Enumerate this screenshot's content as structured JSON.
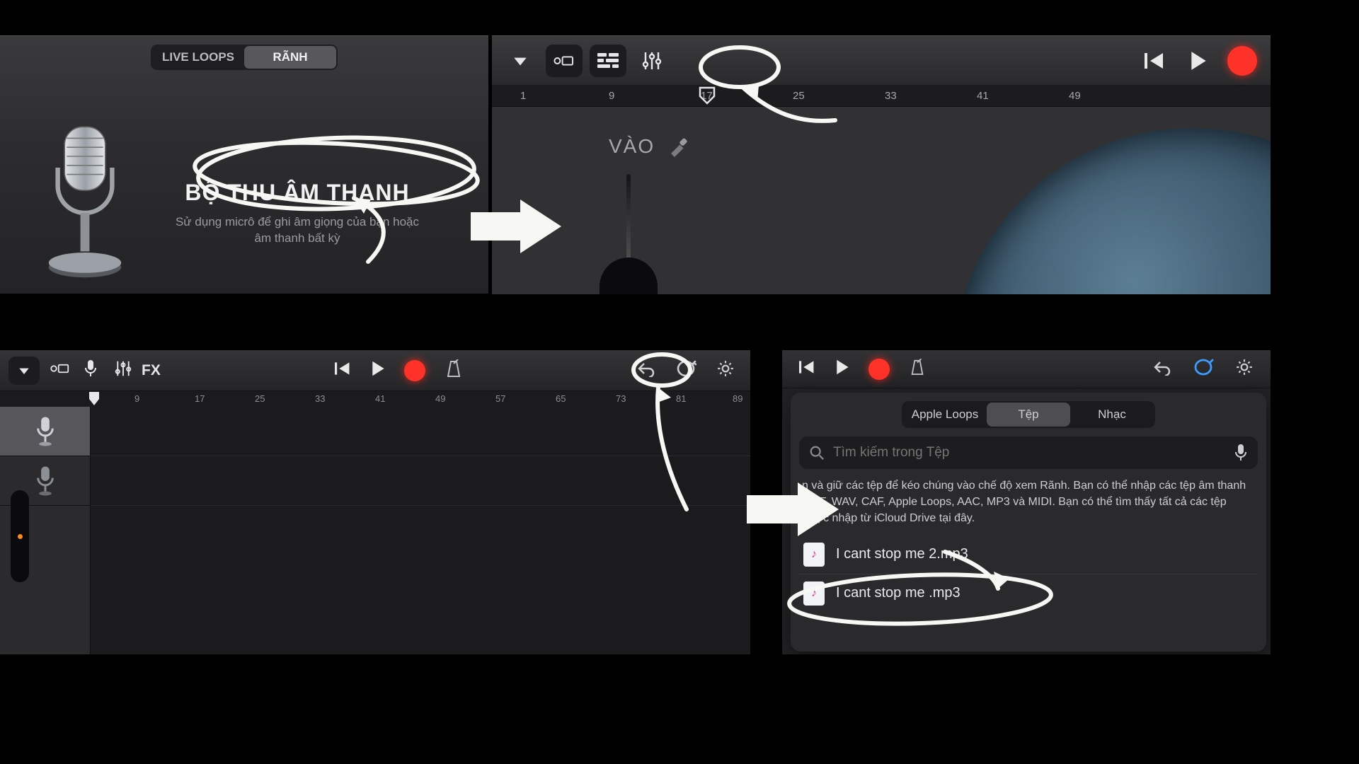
{
  "panel1": {
    "tabs": {
      "left": "LIVE LOOPS",
      "right": "RÃNH"
    },
    "title": "BỘ THU ÂM THANH",
    "desc": "Sử dụng micrô để ghi âm giọng của bạn hoặc âm thanh bất kỳ"
  },
  "panel2": {
    "input_label": "VÀO",
    "ruler": [
      "1",
      "9",
      "17",
      "25",
      "33",
      "41",
      "49"
    ]
  },
  "panel3": {
    "fx_label": "FX",
    "ruler": [
      "9",
      "17",
      "25",
      "33",
      "41",
      "49",
      "57",
      "65",
      "73",
      "81",
      "89"
    ]
  },
  "panel4": {
    "tabs": {
      "a": "Apple Loops",
      "b": "Tệp",
      "c": "Nhạc"
    },
    "search_placeholder": "Tìm kiếm trong Tệp",
    "hint": "n và giữ các tệp để kéo chúng vào chế độ xem Rãnh. Bạn có thể nhập các tệp âm thanh AIFF, WAV, CAF, Apple Loops, AAC, MP3 và MIDI. Bạn có thể tìm thấy tất cả các tệp được nhập từ iCloud Drive tại đây.",
    "files": [
      {
        "name": "I cant stop me  2.mp3"
      },
      {
        "name": "I cant stop me .mp3"
      }
    ]
  }
}
